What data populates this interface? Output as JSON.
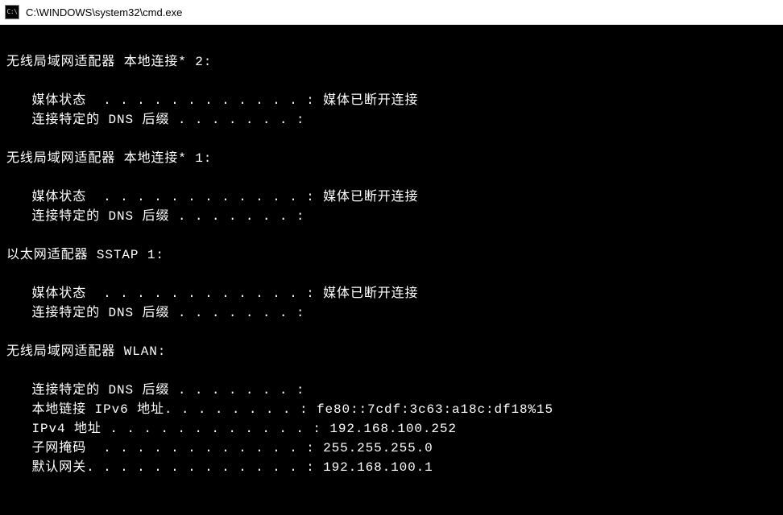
{
  "window": {
    "icon_text": "C:\\",
    "title": "C:\\WINDOWS\\system32\\cmd.exe"
  },
  "terminal_lines": [
    "",
    "无线局域网适配器 本地连接* 2:",
    "",
    "   媒体状态  . . . . . . . . . . . . : 媒体已断开连接",
    "   连接特定的 DNS 后缀 . . . . . . . :",
    "",
    "无线局域网适配器 本地连接* 1:",
    "",
    "   媒体状态  . . . . . . . . . . . . : 媒体已断开连接",
    "   连接特定的 DNS 后缀 . . . . . . . :",
    "",
    "以太网适配器 SSTAP 1:",
    "",
    "   媒体状态  . . . . . . . . . . . . : 媒体已断开连接",
    "   连接特定的 DNS 后缀 . . . . . . . :",
    "",
    "无线局域网适配器 WLAN:",
    "",
    "   连接特定的 DNS 后缀 . . . . . . . :",
    "   本地链接 IPv6 地址. . . . . . . . : fe80::7cdf:3c63:a18c:df18%15",
    "   IPv4 地址 . . . . . . . . . . . . : 192.168.100.252",
    "   子网掩码  . . . . . . . . . . . . : 255.255.255.0",
    "   默认网关. . . . . . . . . . . . . : 192.168.100.1"
  ]
}
